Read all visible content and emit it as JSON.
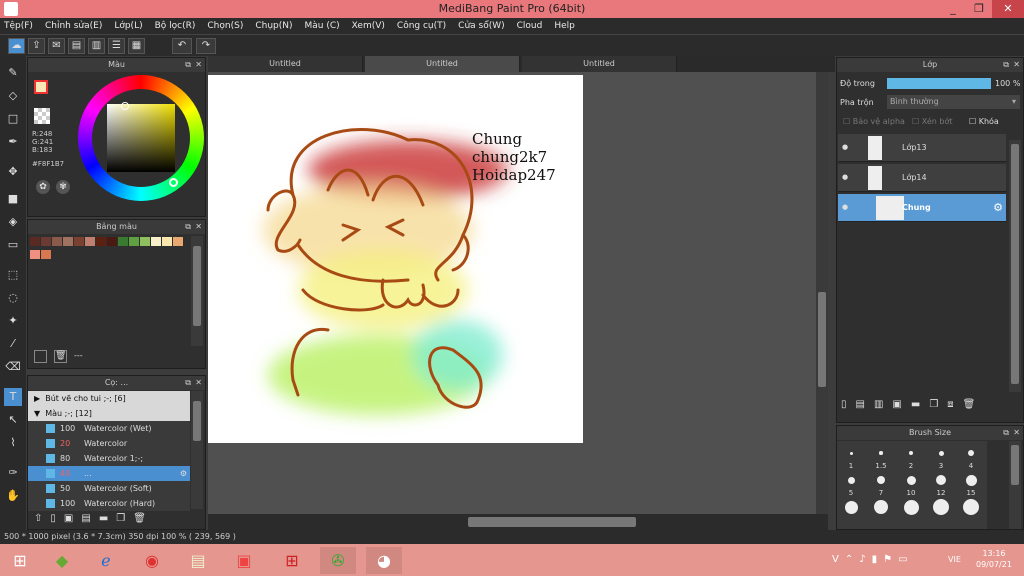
{
  "window": {
    "title": "MediBang Paint Pro (64bit)",
    "min": "_",
    "max": "❐",
    "close": "✕"
  },
  "menu": [
    "Tệp(F)",
    "Chỉnh sửa(E)",
    "Lớp(L)",
    "Bộ lọc(R)",
    "Chọn(S)",
    "Chụp(N)",
    "Màu (C)",
    "Xem(V)",
    "Công cụ(T)",
    "Cửa sổ(W)",
    "Cloud",
    "Help"
  ],
  "color_panel": {
    "title": "Màu",
    "r": "R:248",
    "g": "G:241",
    "b": "B:183",
    "hex": "#F8F1B7"
  },
  "palette_panel": {
    "title": "Bảng màu",
    "footer": "---",
    "colors": [
      "#5a2a22",
      "#6b3b33",
      "#8a5a4a",
      "#a27260",
      "#7a4030",
      "#c08070",
      "#5a2010",
      "#4a1a12",
      "#3a7a30",
      "#5fa040",
      "#8fc060",
      "#f8f0c8",
      "#f8e8b0",
      "#e8a870",
      "#f09080",
      "#d87850"
    ]
  },
  "brush_panel": {
    "title": "Cọ: ...",
    "groups": [
      {
        "label": "Bút vẽ cho tui ;-; [6]",
        "expanded": false
      },
      {
        "label": "Màu ;-; [12]",
        "expanded": true
      }
    ],
    "items": [
      {
        "size": "100",
        "name": "Watercolor (Wet)",
        "red": false,
        "selected": false
      },
      {
        "size": "20",
        "name": "Watercolor",
        "red": true,
        "selected": false
      },
      {
        "size": "80",
        "name": "Watercolor 1;-;",
        "red": false,
        "selected": false
      },
      {
        "size": "40",
        "name": "...",
        "red": true,
        "selected": true
      },
      {
        "size": "50",
        "name": "Watercolor (Soft)",
        "red": false,
        "selected": false
      },
      {
        "size": "100",
        "name": "Watercolor (Hard)",
        "red": false,
        "selected": false
      }
    ]
  },
  "tabs": [
    "Untitled",
    "Untitled",
    "Untitled"
  ],
  "canvas_text": [
    "Chung",
    "chung2k7",
    "Hoidap247"
  ],
  "layer_panel": {
    "title": "Lớp",
    "opacity_label": "Độ trong",
    "opacity_value": "100 %",
    "opacity": 1.0,
    "blend_label": "Pha trộn",
    "blend_value": "Bình thường",
    "protect_alpha": "Bảo vệ alpha",
    "clip": "Xén bớt",
    "lock": "Khóa",
    "layers": [
      {
        "name": "Lớp13",
        "selected": false
      },
      {
        "name": "Lớp14",
        "selected": false
      },
      {
        "name": "Chung",
        "selected": true
      }
    ]
  },
  "brush_size_panel": {
    "title": "Brush Size",
    "labels": [
      "1",
      "1.5",
      "2",
      "3",
      "4",
      "5",
      "7",
      "10",
      "12",
      "15"
    ]
  },
  "status": "500 * 1000 pixel   (3.6 * 7.3cm)   350 dpi   100 %   ( 239, 569 )",
  "taskbar": {
    "lang": "VIE",
    "time": "13:16",
    "date": "09/07/21"
  }
}
